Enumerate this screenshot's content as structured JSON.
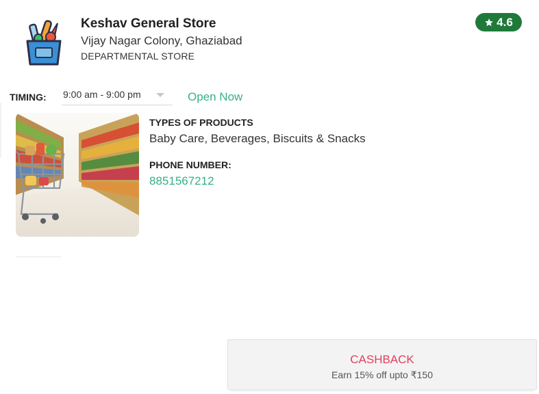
{
  "store": {
    "name": "Keshav General Store",
    "address": "Vijay Nagar Colony, Ghaziabad",
    "category": "DEPARTMENTAL STORE",
    "rating": "4.6",
    "logo_icon": "grocery-bag-icon",
    "rating_icon": "star-icon"
  },
  "timing": {
    "label": "TIMING:",
    "value": "9:00 am - 9:00 pm",
    "status": "Open Now"
  },
  "details": {
    "products_heading": "TYPES OF PRODUCTS",
    "products": "Baby Care, Beverages, Biscuits & Snacks",
    "phone_heading": "PHONE NUMBER:",
    "phone": "8851567212"
  },
  "cashback": {
    "title": "CASHBACK",
    "subtitle": "Earn 15% off upto ₹150"
  },
  "colors": {
    "rating_badge": "#1f7a3a",
    "accent_green": "#35b08b",
    "cashback_red": "#e0405e"
  }
}
